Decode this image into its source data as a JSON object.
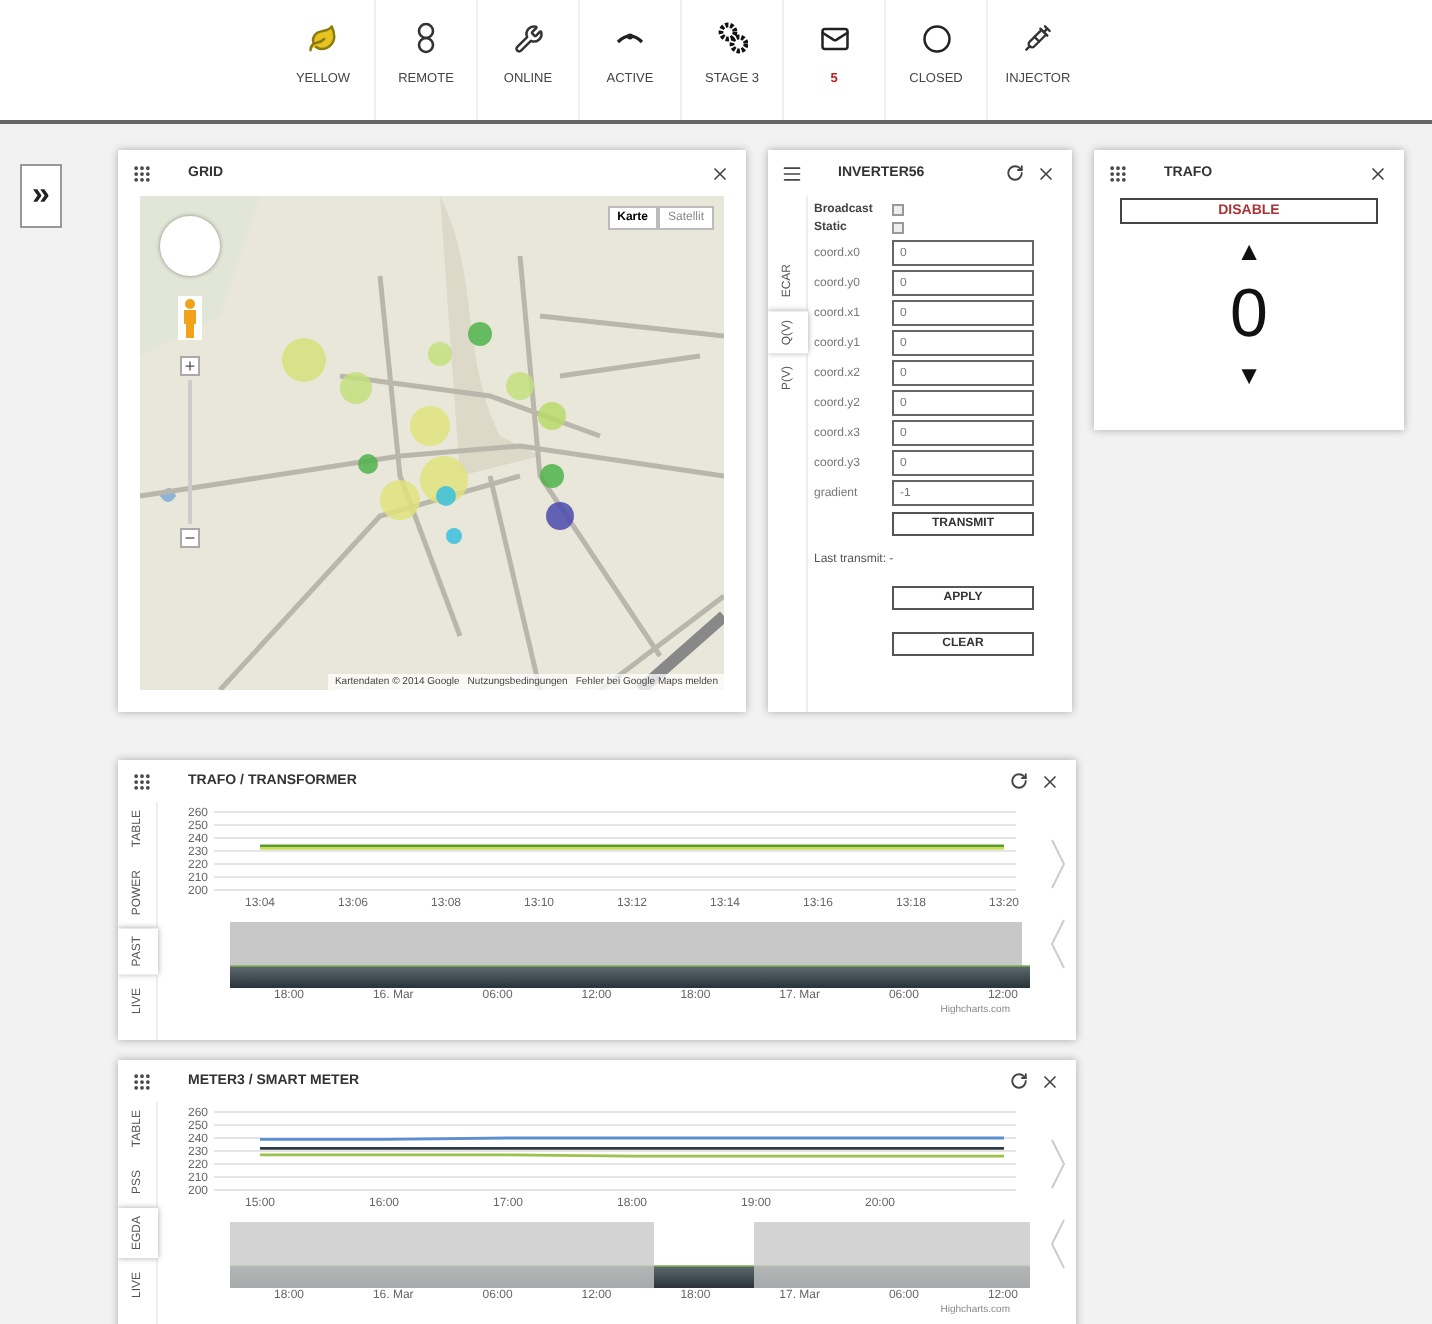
{
  "toolbar": [
    {
      "label": "YELLOW",
      "alert": false
    },
    {
      "label": "REMOTE",
      "alert": false
    },
    {
      "label": "ONLINE",
      "alert": false
    },
    {
      "label": "ACTIVE",
      "alert": false
    },
    {
      "label": "STAGE 3",
      "alert": false
    },
    {
      "label": "5",
      "alert": true
    },
    {
      "label": "CLOSED",
      "alert": false
    },
    {
      "label": "INJECTOR",
      "alert": false
    }
  ],
  "sidebar_toggle": "»",
  "grid_panel": {
    "title": "GRID",
    "map": {
      "kind": "picture",
      "zoom_in": "+",
      "zoom_out": "−",
      "map_types": [
        {
          "label": "Karte",
          "selected": true
        },
        {
          "label": "Satellit",
          "selected": false
        }
      ],
      "attribution": [
        "Kartendaten © 2014 Google",
        "Nutzungsbedingungen",
        "Fehler bei Google Maps melden"
      ]
    }
  },
  "inverter_panel": {
    "title": "INVERTER56",
    "tabs": [
      {
        "label": "ECAR",
        "selected": false
      },
      {
        "label": "Q(V)",
        "selected": true
      },
      {
        "label": "P(V)",
        "selected": false
      }
    ],
    "checkboxes": [
      {
        "label": "Broadcast",
        "checked": false
      },
      {
        "label": "Static",
        "checked": false
      }
    ],
    "fields": [
      {
        "label": "coord.x0",
        "placeholder": "0"
      },
      {
        "label": "coord.y0",
        "placeholder": "0"
      },
      {
        "label": "coord.x1",
        "placeholder": "0"
      },
      {
        "label": "coord.y1",
        "placeholder": "0"
      },
      {
        "label": "coord.x2",
        "placeholder": "0"
      },
      {
        "label": "coord.y2",
        "placeholder": "0"
      },
      {
        "label": "coord.x3",
        "placeholder": "0"
      },
      {
        "label": "coord.y3",
        "placeholder": "0"
      },
      {
        "label": "gradient",
        "placeholder": "-1"
      }
    ],
    "transmit_button": "TRANSMIT",
    "last_transmit": "Last transmit: -",
    "buttons": [
      "APPLY",
      "CLEAR"
    ]
  },
  "trafo_panel": {
    "title": "TRAFO",
    "disable_button": "DISABLE",
    "up": "▲",
    "value": "0",
    "down": "▼"
  },
  "chart_panels": [
    {
      "title": "TRAFO / TRANSFORMER",
      "tabs": [
        {
          "label": "TABLE",
          "selected": false
        },
        {
          "label": "POWER",
          "selected": false
        },
        {
          "label": "PAST",
          "selected": true
        },
        {
          "label": "LIVE",
          "selected": false
        }
      ],
      "chart_data": {
        "type": "line",
        "grid": true,
        "ylim": [
          200,
          260
        ],
        "yticks": [
          200,
          210,
          220,
          230,
          240,
          250,
          260
        ],
        "categories": [
          "13:04",
          "13:06",
          "13:08",
          "13:10",
          "13:12",
          "13:14",
          "13:16",
          "13:18",
          "13:20"
        ],
        "series": [
          {
            "color": "#5a9e2f",
            "values": [
              234,
              234,
              234,
              234,
              234,
              234,
              234,
              234,
              234
            ]
          },
          {
            "color": "#c9dc5a",
            "values": [
              232,
              232,
              232,
              232,
              232,
              232,
              232,
              232,
              232
            ]
          }
        ]
      },
      "navigator": {
        "kind": "full",
        "labels": [
          "18:00",
          "16. Mar",
          "06:00",
          "12:00",
          "18:00",
          "17. Mar",
          "06:00",
          "12:00"
        ]
      },
      "credit": "Highcharts.com"
    },
    {
      "title": "METER3 / SMART METER",
      "tabs": [
        {
          "label": "TABLE",
          "selected": false
        },
        {
          "label": "PSS",
          "selected": false
        },
        {
          "label": "EGDA",
          "selected": true
        },
        {
          "label": "LIVE",
          "selected": false
        }
      ],
      "chart_data": {
        "type": "line",
        "grid": true,
        "ylim": [
          200,
          260
        ],
        "yticks": [
          200,
          210,
          220,
          230,
          240,
          250,
          260
        ],
        "categories": [
          "15:00",
          "16:00",
          "17:00",
          "18:00",
          "19:00",
          "20:00",
          null
        ],
        "series": [
          {
            "color": "#5b8fd0",
            "values": [
              239,
              239,
              240,
              240,
              240,
              240,
              240
            ]
          },
          {
            "color": "#2d3a44",
            "values": [
              232,
              232,
              232,
              232,
              232,
              232,
              232
            ]
          },
          {
            "color": "#9cc24a",
            "values": [
              227,
              227,
              227,
              226,
              226,
              226,
              226
            ]
          }
        ]
      },
      "navigator": {
        "kind": "window",
        "labels": [
          "18:00",
          "16. Mar",
          "06:00",
          "12:00",
          "18:00",
          "17. Mar",
          "06:00",
          "12:00"
        ]
      },
      "credit": "Highcharts.com"
    }
  ]
}
